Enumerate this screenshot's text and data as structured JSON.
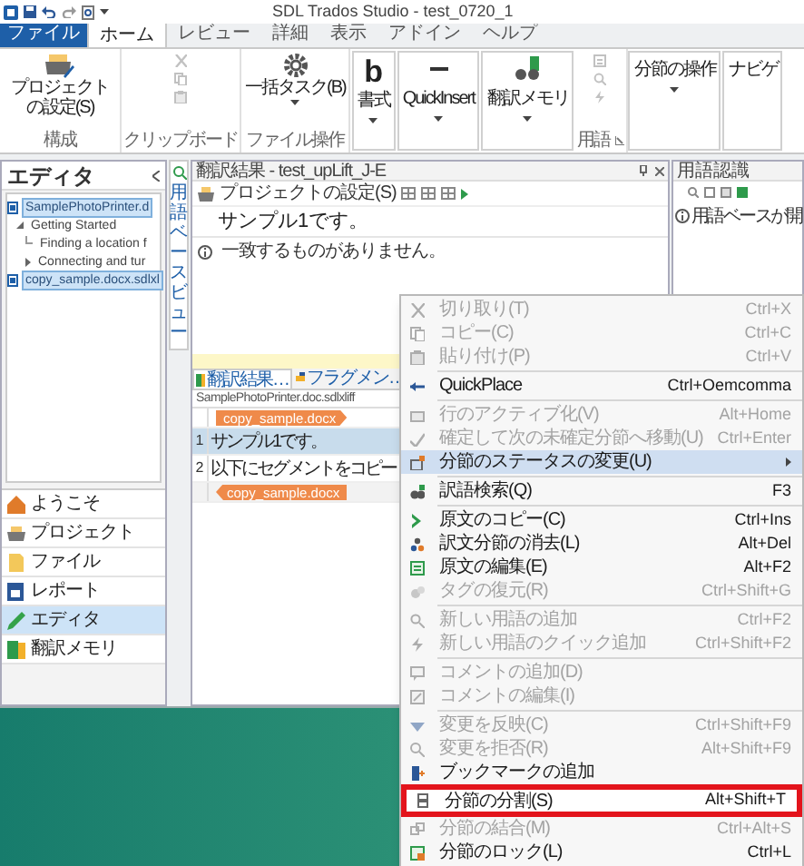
{
  "window": {
    "title": "SDL Trados Studio - test_0720_1"
  },
  "ribbon_tabs": [
    {
      "label": "ファイル",
      "kind": "file",
      "selected": false
    },
    {
      "label": "ホーム",
      "kind": "tab",
      "selected": true
    },
    {
      "label": "レビュー",
      "kind": "tab",
      "selected": false
    },
    {
      "label": "詳細",
      "kind": "tab",
      "selected": false
    },
    {
      "label": "表示",
      "kind": "tab",
      "selected": false
    },
    {
      "label": "アドイン",
      "kind": "tab",
      "selected": false
    },
    {
      "label": "ヘルプ",
      "kind": "tab",
      "selected": false
    }
  ],
  "ribbon_groups": [
    {
      "kind": "large",
      "button": "プロジェクトの設定(S)",
      "dropdown": false,
      "label": "構成"
    },
    {
      "kind": "small",
      "disabled": true,
      "label": "クリップボード"
    },
    {
      "kind": "large",
      "button": "一括タスク(B)",
      "dropdown": true,
      "label": "ファイル操作"
    },
    {
      "kind": "collapsed",
      "glyph": "b",
      "button": "書式",
      "dropdown": true
    },
    {
      "kind": "collapsed",
      "button": "QuickInsert",
      "dropdown": true
    },
    {
      "kind": "collapsed",
      "button": "翻訳メモリ",
      "dropdown": true
    },
    {
      "kind": "small",
      "disabled": true,
      "label": "用語",
      "launcher": true
    },
    {
      "kind": "collapsed",
      "button": "分節の操作",
      "dropdown": true
    },
    {
      "kind": "collapsed",
      "button": "ナビゲ",
      "dropdown": false
    }
  ],
  "editor_panel": {
    "title": "エディタ",
    "tree": [
      {
        "label": "SamplePhotoPrinter.d",
        "kind": "file",
        "selected": true,
        "children": [
          {
            "label": "Getting Started",
            "kind": "section",
            "expanded": true,
            "selected": false,
            "children": [
              {
                "label": "Finding a location f",
                "kind": "section",
                "selected": false
              },
              {
                "label": "Connecting and tur",
                "kind": "section",
                "expanded": false,
                "selected": false
              }
            ]
          }
        ]
      },
      {
        "label": "copy_sample.docx.sdlxl",
        "kind": "file",
        "selected": true
      }
    ]
  },
  "navigation": [
    {
      "label": "ようこそ",
      "selected": false
    },
    {
      "label": "プロジェクト",
      "selected": false
    },
    {
      "label": "ファイル",
      "selected": false
    },
    {
      "label": "レポート",
      "selected": false
    },
    {
      "label": "エディタ",
      "selected": true
    },
    {
      "label": "翻訳メモリ",
      "selected": false
    }
  ],
  "side_strip": {
    "label": "用語ベースビュー"
  },
  "translation_results": {
    "title": "翻訳結果 - test_upLift_J-E",
    "toolbar_label": "プロジェクトの設定(S)",
    "source": "サンプル1です。",
    "message": "一致するものがありません。"
  },
  "editor_tabs": [
    {
      "label": "翻訳結果…",
      "selected": true
    },
    {
      "label": "フラグメン…",
      "selected": false
    }
  ],
  "document": {
    "name": "SamplePhotoPrinter.doc.sdlxliff",
    "rows": [
      {
        "kind": "open_tag",
        "text": "copy_sample.docx"
      },
      {
        "kind": "segment",
        "number": "1",
        "text": "サンプル1です。",
        "selected": true
      },
      {
        "kind": "segment",
        "number": "2",
        "text": "以下にセグメントをコピー",
        "selected": false
      },
      {
        "kind": "close_tag",
        "text": "copy_sample.docx"
      }
    ]
  },
  "term_recognition": {
    "title": "用語認識",
    "message": "用語ベースが開"
  },
  "context_menu": {
    "items": [
      {
        "kind": "item",
        "label": "切り取り(T)",
        "shortcut": "Ctrl+X",
        "disabled": true,
        "selected": false,
        "outlined": false
      },
      {
        "kind": "item",
        "label": "コピー(C)",
        "shortcut": "Ctrl+C",
        "disabled": true,
        "selected": false,
        "outlined": false
      },
      {
        "kind": "item",
        "label": "貼り付け(P)",
        "shortcut": "Ctrl+V",
        "disabled": true,
        "selected": false,
        "outlined": false
      },
      {
        "kind": "separator"
      },
      {
        "kind": "item",
        "label": "QuickPlace",
        "shortcut": "Ctrl+Oemcomma",
        "disabled": false,
        "selected": false,
        "outlined": false
      },
      {
        "kind": "separator"
      },
      {
        "kind": "item",
        "label": "行のアクティブ化(V)",
        "shortcut": "Alt+Home",
        "disabled": true,
        "selected": false,
        "outlined": false
      },
      {
        "kind": "item",
        "label": "確定して次の未確定分節へ移動(U)",
        "shortcut": "Ctrl+Enter",
        "disabled": true,
        "selected": false,
        "outlined": false
      },
      {
        "kind": "item",
        "label": "分節のステータスの変更(U)",
        "submenu": true,
        "disabled": false,
        "selected": true,
        "outlined": false
      },
      {
        "kind": "separator"
      },
      {
        "kind": "item",
        "label": "訳語検索(Q)",
        "shortcut": "F3",
        "disabled": false,
        "selected": false,
        "outlined": false
      },
      {
        "kind": "separator"
      },
      {
        "kind": "item",
        "label": "原文のコピー(C)",
        "shortcut": "Ctrl+Ins",
        "disabled": false,
        "selected": false,
        "outlined": false
      },
      {
        "kind": "item",
        "label": "訳文分節の消去(L)",
        "shortcut": "Alt+Del",
        "disabled": false,
        "selected": false,
        "outlined": false
      },
      {
        "kind": "item",
        "label": "原文の編集(E)",
        "shortcut": "Alt+F2",
        "disabled": false,
        "selected": false,
        "outlined": false
      },
      {
        "kind": "item",
        "label": "タグの復元(R)",
        "shortcut": "Ctrl+Shift+G",
        "disabled": true,
        "selected": false,
        "outlined": false
      },
      {
        "kind": "separator"
      },
      {
        "kind": "item",
        "label": "新しい用語の追加",
        "shortcut": "Ctrl+F2",
        "disabled": true,
        "selected": false,
        "outlined": false
      },
      {
        "kind": "item",
        "label": "新しい用語のクイック追加",
        "shortcut": "Ctrl+Shift+F2",
        "disabled": true,
        "selected": false,
        "outlined": false
      },
      {
        "kind": "separator"
      },
      {
        "kind": "item",
        "label": "コメントの追加(D)",
        "disabled": true,
        "selected": false,
        "outlined": false
      },
      {
        "kind": "item",
        "label": "コメントの編集(I)",
        "disabled": true,
        "selected": false,
        "outlined": false
      },
      {
        "kind": "separator"
      },
      {
        "kind": "item",
        "label": "変更を反映(C)",
        "shortcut": "Ctrl+Shift+F9",
        "disabled": true,
        "selected": false,
        "outlined": false
      },
      {
        "kind": "item",
        "label": "変更を拒否(R)",
        "shortcut": "Alt+Shift+F9",
        "disabled": true,
        "selected": false,
        "outlined": false
      },
      {
        "kind": "item",
        "label": "ブックマークの追加",
        "disabled": false,
        "selected": false,
        "outlined": false
      },
      {
        "kind": "item",
        "label": "分節の分割(S)",
        "shortcut": "Alt+Shift+T",
        "disabled": false,
        "selected": false,
        "outlined": true
      },
      {
        "kind": "item",
        "label": "分節の結合(M)",
        "shortcut": "Ctrl+Alt+S",
        "disabled": true,
        "selected": false,
        "outlined": false
      },
      {
        "kind": "item",
        "label": "分節のロック(L)",
        "shortcut": "Ctrl+L",
        "disabled": false,
        "selected": false,
        "outlined": false
      }
    ]
  }
}
